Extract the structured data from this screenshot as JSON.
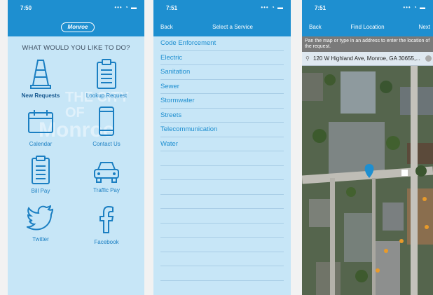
{
  "screen1": {
    "time": "7:50",
    "logo": "Monroe",
    "heading": "WHAT WOULD YOU LIKE TO DO?",
    "watermark_line1": "THE CITY OF",
    "watermark_line2": "Monroe",
    "tiles": [
      {
        "label": "New Requests",
        "icon": "traffic-cone-icon"
      },
      {
        "label": "Lookup Request",
        "icon": "clipboard-icon"
      },
      {
        "label": "Calendar",
        "icon": "calendar-icon"
      },
      {
        "label": "Contact Us",
        "icon": "phone-icon"
      },
      {
        "label": "Bill Pay",
        "icon": "bill-icon"
      },
      {
        "label": "Traffic Pay",
        "icon": "car-icon"
      },
      {
        "label": "Twitter",
        "icon": "twitter-icon"
      },
      {
        "label": "Facebook",
        "icon": "facebook-icon"
      }
    ]
  },
  "screen2": {
    "time": "7:51",
    "back": "Back",
    "title": "Select a Service",
    "services": [
      "Code Enforcement",
      "Electric",
      "Sanitation",
      "Sewer",
      "Stormwater",
      "Streets",
      "Telecommunication",
      "Water"
    ]
  },
  "screen3": {
    "time": "7:51",
    "back": "Back",
    "title": "Find Location",
    "next": "Next",
    "instruction": "Pan the map or type in an address to enter the location of the request.",
    "address": "120 W Highland Ave, Monroe, GA  30655,..."
  },
  "colors": {
    "accent": "#1e8fd0",
    "panel": "#c7e6f7",
    "label": "#1b7fc2"
  }
}
